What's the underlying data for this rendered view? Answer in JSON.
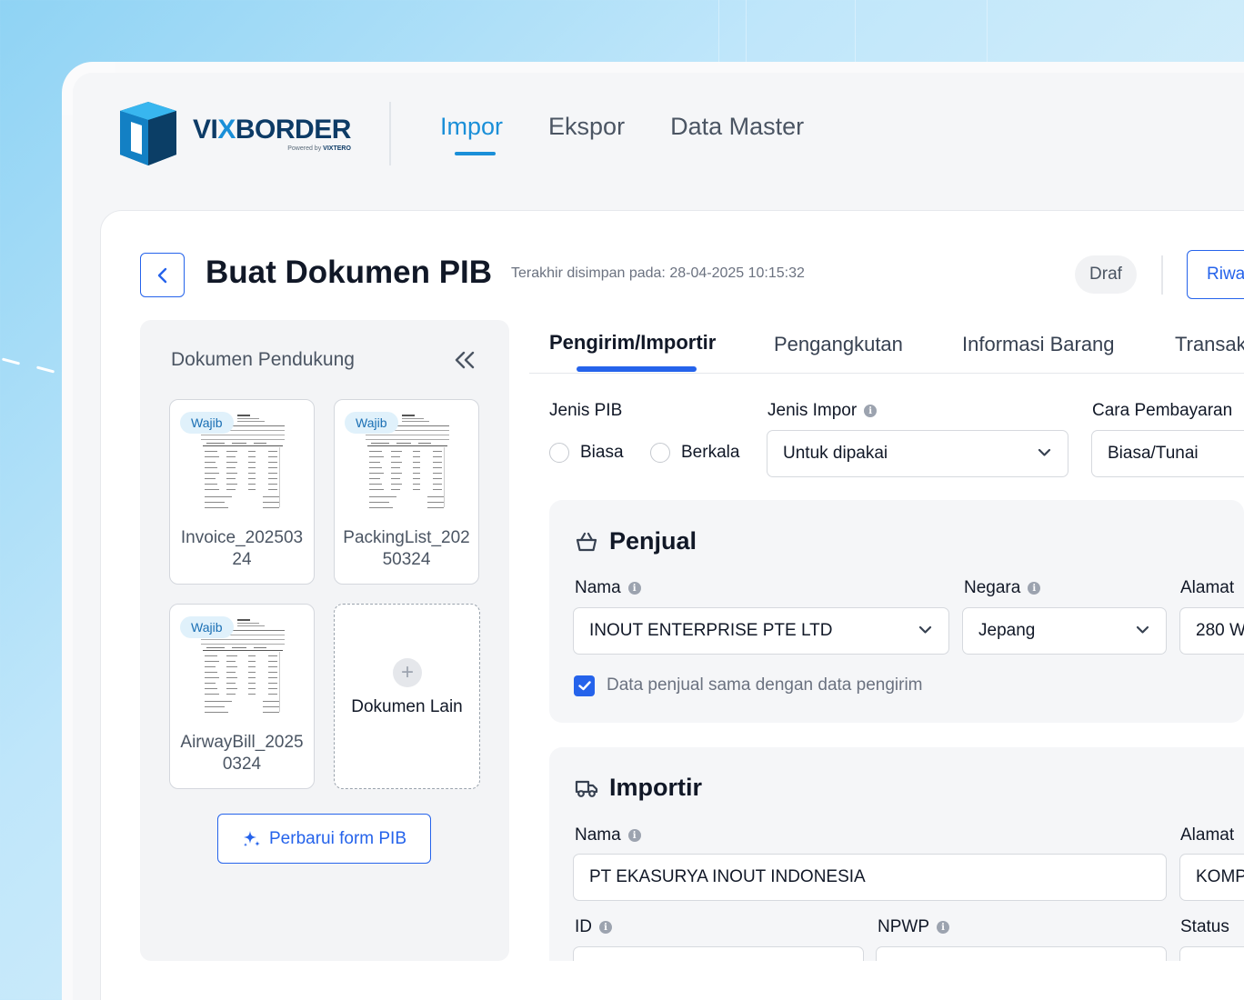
{
  "brand": {
    "logo_text_a": "VI",
    "logo_text_x": "X",
    "logo_text_b": "BORDER",
    "powered_by": "Powered by ",
    "powered_brand": "VIXTERO"
  },
  "nav": {
    "items": [
      {
        "label": "Impor",
        "active": true
      },
      {
        "label": "Ekspor",
        "active": false
      },
      {
        "label": "Data Master",
        "active": false
      }
    ]
  },
  "page": {
    "title": "Buat Dokumen PIB",
    "last_saved": "Terakhir disimpan pada: 28-04-2025 10:15:32",
    "status_badge": "Draf",
    "history_button": "Riwa"
  },
  "side_panel": {
    "title": "Dokumen Pendukung",
    "documents": [
      {
        "badge": "Wajib",
        "name": "Invoice_20250324"
      },
      {
        "badge": "Wajib",
        "name": "PackingList_20250324"
      },
      {
        "badge": "Wajib",
        "name": "AirwayBill_20250324"
      }
    ],
    "add_document": "Dokumen Lain",
    "update_button": "Perbarui form PIB"
  },
  "tabs": [
    {
      "label": "Pengirim/Importir",
      "active": true
    },
    {
      "label": "Pengangkutan",
      "active": false
    },
    {
      "label": "Informasi Barang",
      "active": false
    },
    {
      "label": "Transak",
      "active": false
    }
  ],
  "general": {
    "jenis_pib_label": "Jenis PIB",
    "jenis_pib_options": [
      "Biasa",
      "Berkala"
    ],
    "jenis_impor_label": "Jenis Impor",
    "jenis_impor_value": "Untuk dipakai",
    "cara_pembayaran_label": "Cara Pembayaran",
    "cara_pembayaran_value": "Biasa/Tunai"
  },
  "penjual": {
    "title": "Penjual",
    "nama_label": "Nama",
    "nama_value": "INOUT ENTERPRISE PTE LTD",
    "negara_label": "Negara",
    "negara_value": "Jepang",
    "alamat_label": "Alamat",
    "alamat_value": "280 W",
    "same_as_sender_label": "Data penjual sama dengan data pengirim",
    "same_as_sender_checked": true
  },
  "importir": {
    "title": "Importir",
    "nama_label": "Nama",
    "nama_value": "PT EKASURYA INOUT INDONESIA",
    "alamat_label": "Alamat",
    "alamat_value": "KOMP",
    "id_label": "ID",
    "npwp_label": "NPWP",
    "status_label": "Status"
  },
  "colors": {
    "accent": "#2563eb",
    "brand_blue": "#1a8fd8",
    "brand_navy": "#0d3b66"
  }
}
